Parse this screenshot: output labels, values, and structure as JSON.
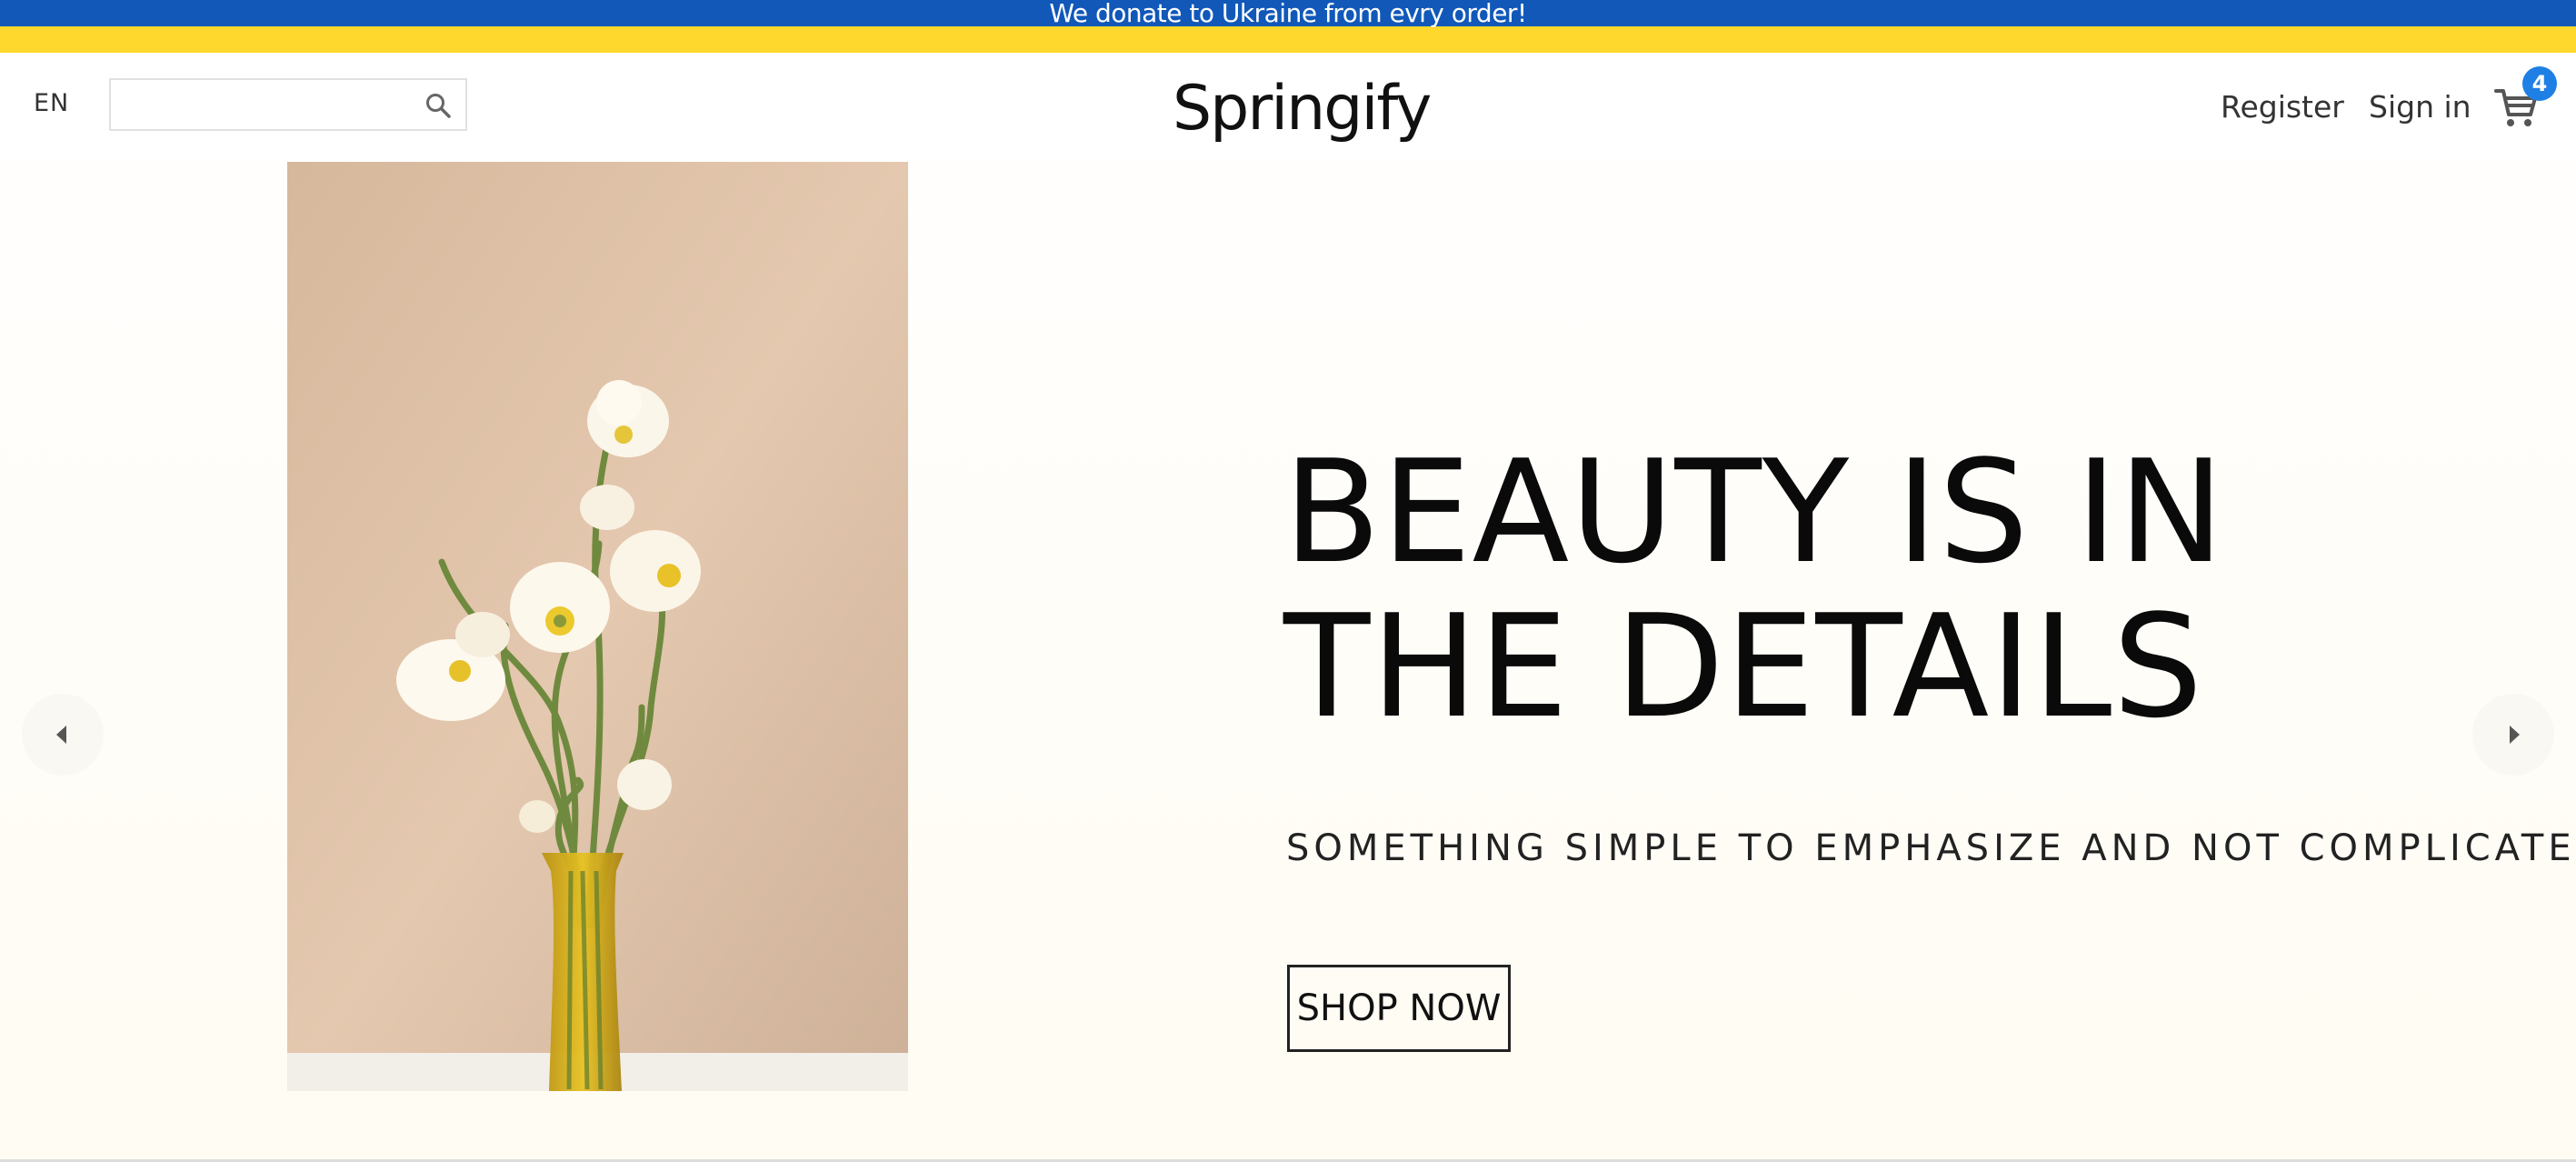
{
  "banner": {
    "text": "We donate to Ukraine from evry order!",
    "colors": {
      "top": "#1158b9",
      "bottom": "#fed82c"
    }
  },
  "header": {
    "language": "EN",
    "search": {
      "value": "",
      "placeholder": ""
    },
    "logo": "Springify",
    "register_label": "Register",
    "signin_label": "Sign in",
    "cart_count": "4"
  },
  "hero": {
    "headline": "BEAUTY IS IN THE DETAILS",
    "subheadline": "SOMETHING SIMPLE TO EMPHASIZE AND NOT COMPLICATE",
    "cta_label": "SHOP NOW"
  },
  "icons": {
    "search": "search-icon",
    "cart": "shopping-cart-icon",
    "prev": "caret-left-icon",
    "next": "caret-right-icon"
  },
  "colors": {
    "accent": "#1e7fe5",
    "hero_bg": "#fffcf3",
    "photo_bg": "#d9bda2"
  }
}
